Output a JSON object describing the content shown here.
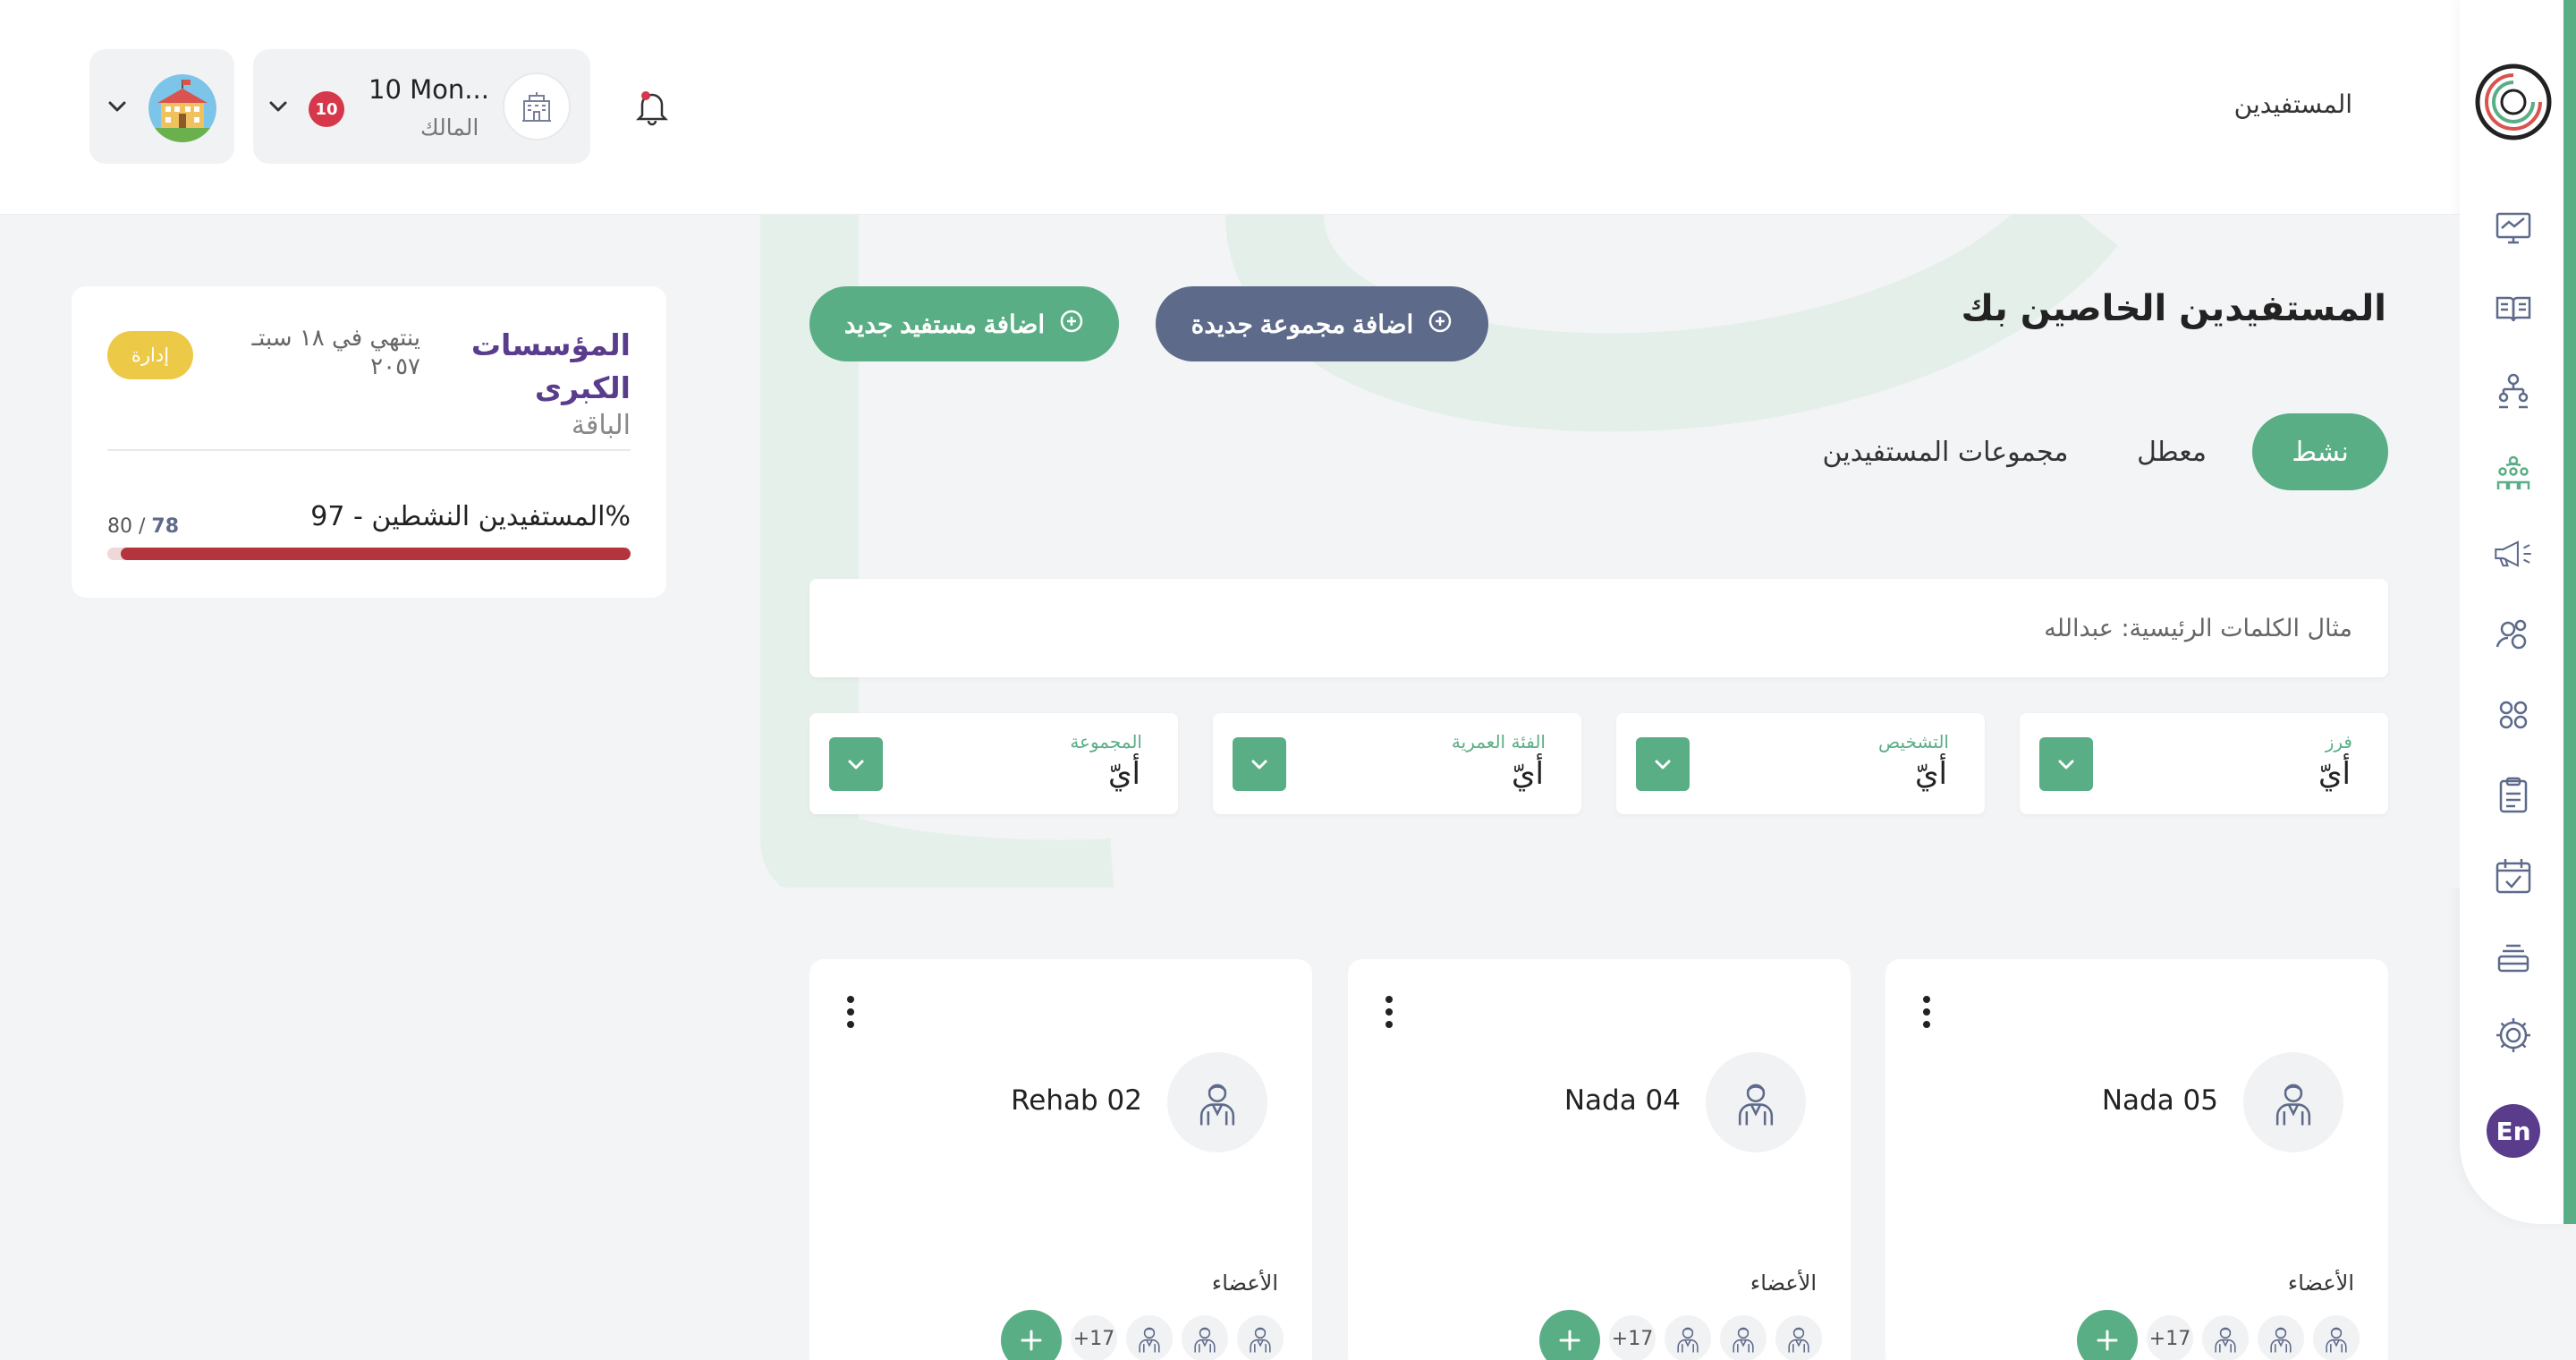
{
  "header": {
    "page_name": "المستفيدين",
    "user_name": "10 Mon...",
    "user_role": "المالك",
    "notification_count": "10"
  },
  "sidebar": {
    "icons": [
      "logo-icon",
      "dashboard-icon",
      "book-icon",
      "hierarchy-icon",
      "beneficiaries-icon",
      "megaphone-icon",
      "users-icon",
      "groups-icon",
      "clipboard-icon",
      "calendar-check-icon",
      "stack-icon",
      "settings-icon"
    ],
    "active_item": "beneficiaries-icon",
    "lang_label": "En"
  },
  "main": {
    "title": "المستفيدين الخاصين بك",
    "add_group_label": "اضافة مجموعة جديدة",
    "add_beneficiary_label": "اضافة مستفيد جديد",
    "tabs": [
      {
        "label": "نشط",
        "active": true
      },
      {
        "label": "معطل",
        "active": false
      },
      {
        "label": "مجموعات المستفيدين",
        "active": false
      }
    ],
    "search_placeholder": "مثال الكلمات الرئيسية: عبدالله",
    "filters": [
      {
        "label": "فرز",
        "value": "أيّ"
      },
      {
        "label": "التشخيص",
        "value": "أيّ"
      },
      {
        "label": "الفئة العمرية",
        "value": "أيّ"
      },
      {
        "label": "المجموعة",
        "value": "أيّ"
      }
    ]
  },
  "plan": {
    "name": "المؤسسات الكبرى",
    "label": "الباقة",
    "expiry": "ينتهي في ١٨ سبتـ ٢٠٥٧",
    "manage_label": "إدارة",
    "active_label": "المستفيدين النشطين - 97%",
    "active_current": "78",
    "active_separator": " / ",
    "active_total": "80",
    "progress_fraction": 0.975
  },
  "groups": [
    {
      "name": "Nada 05",
      "members_label": "الأعضاء",
      "more_count": "+17"
    },
    {
      "name": "Nada 04",
      "members_label": "الأعضاء",
      "more_count": "+17"
    },
    {
      "name": "Rehab 02",
      "members_label": "الأعضاء",
      "more_count": "+17"
    }
  ],
  "colors": {
    "primary_green": "#5aae85",
    "slate": "#5d6a8a",
    "purple": "#5a3c8c",
    "badge_yellow": "#edc948",
    "progress_red": "#b4343e",
    "notification_red": "#d7374a"
  }
}
